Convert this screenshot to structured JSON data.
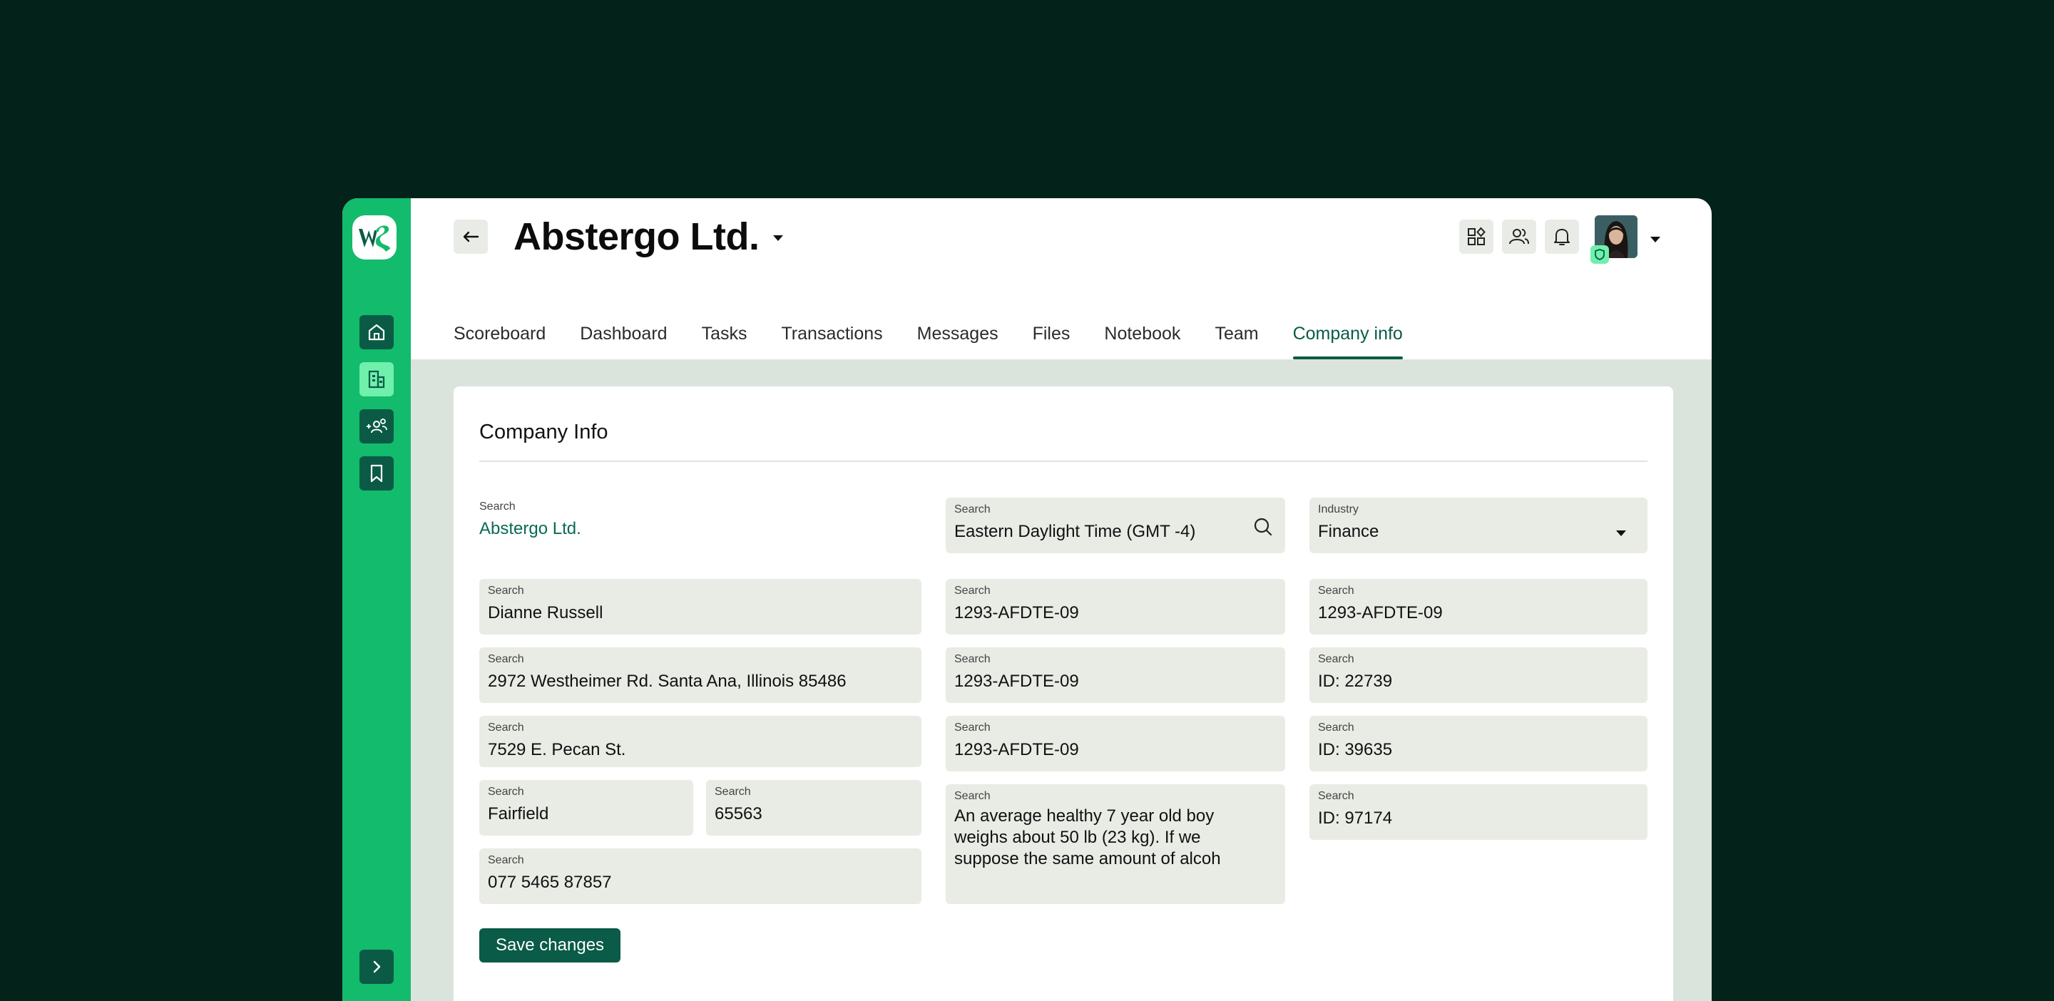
{
  "header": {
    "company_name": "Abstergo Ltd."
  },
  "sidebar": {
    "items": [
      {
        "icon": "home-icon"
      },
      {
        "icon": "building-icon"
      },
      {
        "icon": "add-users-icon"
      },
      {
        "icon": "bookmark-icon"
      }
    ]
  },
  "tabs": [
    "Scoreboard",
    "Dashboard",
    "Tasks",
    "Transactions",
    "Messages",
    "Files",
    "Notebook",
    "Team",
    "Company info"
  ],
  "active_tab": "Company info",
  "card": {
    "title": "Company Info",
    "fields": {
      "company": {
        "label": "Search",
        "value": "Abstergo Ltd."
      },
      "timezone": {
        "label": "Search",
        "value": "Eastern Daylight Time (GMT -4)"
      },
      "industry": {
        "label": "Industry",
        "value": "Finance"
      },
      "contact": {
        "label": "Search",
        "value": "Dianne Russell"
      },
      "address1": {
        "label": "Search",
        "value": "2972 Westheimer Rd. Santa Ana, Illinois 85486"
      },
      "address2": {
        "label": "Search",
        "value": "7529 E. Pecan St."
      },
      "city": {
        "label": "Search",
        "value": "Fairfield"
      },
      "zip": {
        "label": "Search",
        "value": "65563"
      },
      "phone": {
        "label": "Search",
        "value": "077 5465 87857"
      },
      "mid1": {
        "label": "Search",
        "value": "1293-AFDTE-09"
      },
      "mid2": {
        "label": "Search",
        "value": "1293-AFDTE-09"
      },
      "mid3": {
        "label": "Search",
        "value": "1293-AFDTE-09"
      },
      "notes": {
        "label": "Search",
        "value": "An average healthy 7 year old boy weighs about 50 lb (23 kg). If we suppose the same amount of alcoh"
      },
      "right1": {
        "label": "Search",
        "value": "1293-AFDTE-09"
      },
      "right2": {
        "label": "Search",
        "value": "ID: 22739"
      },
      "right3": {
        "label": "Search",
        "value": "ID: 39635"
      },
      "right4": {
        "label": "Search",
        "value": "ID: 97174"
      }
    },
    "save_label": "Save changes"
  },
  "colors": {
    "background": "#03221a",
    "sidebar": "#13bb6c",
    "accent": "#0a5b47",
    "highlight": "#6ff0ab",
    "field_bg": "#e9ebe5",
    "content_bg": "#dbe4dc"
  }
}
